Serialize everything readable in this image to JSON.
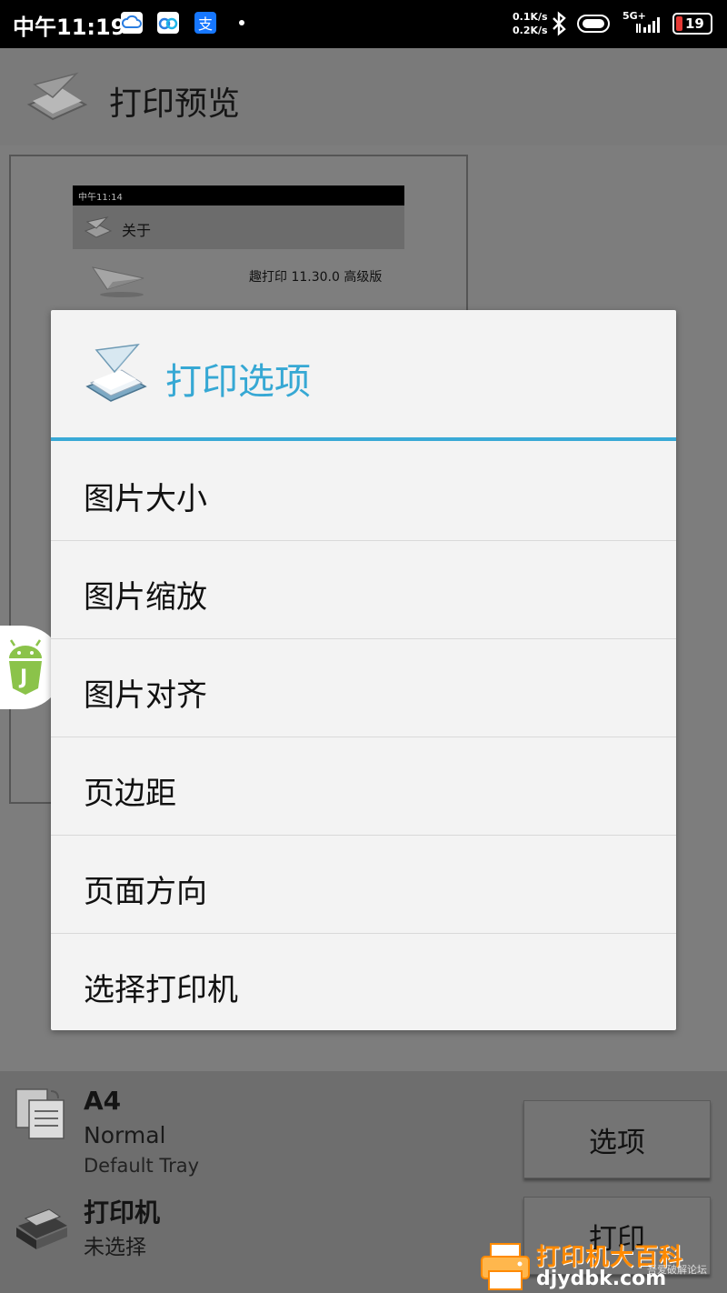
{
  "status_bar": {
    "time": "中午11:19",
    "net_up": "0.1K/s",
    "net_down": "0.2K/s",
    "network": "5G+",
    "battery": "19",
    "battery_color": "#e53935"
  },
  "titlebar": {
    "title": "打印预览"
  },
  "preview": {
    "status_time": "中午11:14",
    "bar_label": "关于",
    "version": "趣打印 11.30.0 高级版"
  },
  "dialog": {
    "title": "打印选项",
    "accent_color": "#39a9d6",
    "items": [
      {
        "label": "图片大小"
      },
      {
        "label": "图片缩放"
      },
      {
        "label": "图片对齐"
      },
      {
        "label": "页边距"
      },
      {
        "label": "页面方向"
      },
      {
        "label": "选择打印机"
      }
    ]
  },
  "bottom": {
    "paper_size": "A4",
    "paper_type": "Normal",
    "paper_tray": "Default Tray",
    "printer_label": "打印机",
    "printer_status": "未选择",
    "options_button": "选项",
    "print_button": "打印"
  },
  "watermark": {
    "title": "打印机大百科",
    "url": "djydbk.com",
    "small": "吾爱破解论坛"
  }
}
